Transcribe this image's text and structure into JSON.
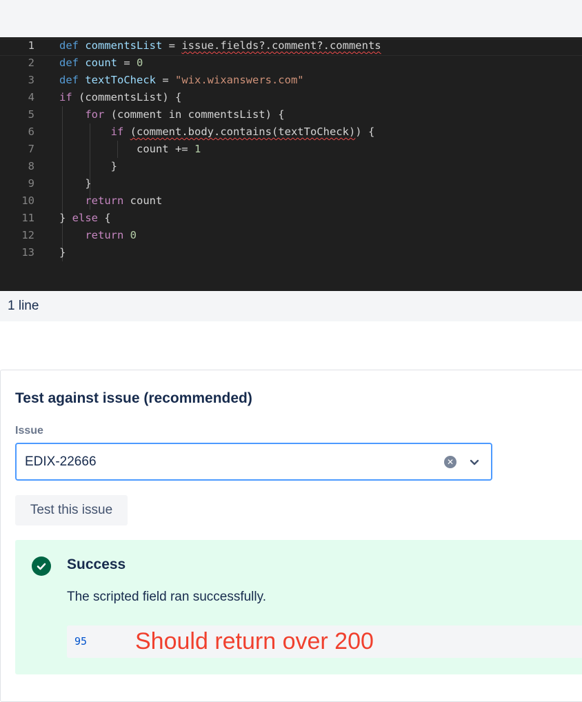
{
  "editor": {
    "line_numbers": [
      "1",
      "2",
      "3",
      "4",
      "5",
      "6",
      "7",
      "8",
      "9",
      "10",
      "11",
      "12",
      "13"
    ],
    "lines": [
      [
        {
          "t": "def",
          "c": "kw-def"
        },
        {
          "t": " "
        },
        {
          "t": "commentsList",
          "c": "var"
        },
        {
          "t": " = "
        },
        {
          "t": "issue.fields?.comment?.comments",
          "c": "squig"
        }
      ],
      [
        {
          "t": "def",
          "c": "kw-def"
        },
        {
          "t": " "
        },
        {
          "t": "count",
          "c": "var"
        },
        {
          "t": " = "
        },
        {
          "t": "0",
          "c": "num"
        }
      ],
      [
        {
          "t": "def",
          "c": "kw-def"
        },
        {
          "t": " "
        },
        {
          "t": "textToCheck",
          "c": "var"
        },
        {
          "t": " = "
        },
        {
          "t": "\"wix.wixanswers.com\"",
          "c": "str"
        }
      ],
      [
        {
          "t": "if",
          "c": "kw"
        },
        {
          "t": " (commentsList) {"
        }
      ],
      [
        {
          "t": "    "
        },
        {
          "t": "for",
          "c": "kw"
        },
        {
          "t": " (comment in commentsList) {"
        }
      ],
      [
        {
          "t": "        "
        },
        {
          "t": "if",
          "c": "kw"
        },
        {
          "t": " "
        },
        {
          "t": "(comment.body.contains(textToCheck)",
          "c": "squig"
        },
        {
          "t": ") {"
        }
      ],
      [
        {
          "t": "            count += "
        },
        {
          "t": "1",
          "c": "num"
        }
      ],
      [
        {
          "t": "        }"
        }
      ],
      [
        {
          "t": "    }"
        }
      ],
      [
        {
          "t": "    "
        },
        {
          "t": "return",
          "c": "kw"
        },
        {
          "t": " count"
        }
      ],
      [
        {
          "t": "} "
        },
        {
          "t": "else",
          "c": "kw"
        },
        {
          "t": " {"
        }
      ],
      [
        {
          "t": "    "
        },
        {
          "t": "return",
          "c": "kw"
        },
        {
          "t": " "
        },
        {
          "t": "0",
          "c": "num"
        }
      ],
      [
        {
          "t": "}"
        }
      ]
    ]
  },
  "line_count_label": "1 line",
  "test_panel": {
    "title": "Test against issue (recommended)",
    "issue_label": "Issue",
    "issue_value": "EDIX-22666",
    "clear_icon": "clear-icon",
    "chevron_icon": "chevron-down-icon",
    "test_button_label": "Test this issue"
  },
  "result": {
    "status_icon": "check-circle-icon",
    "title": "Success",
    "message": "The scripted field ran successfully.",
    "value": "95",
    "annotation": "Should return over 200"
  },
  "colors": {
    "editor_bg": "#1f1f1f",
    "focus_border": "#4c9aff",
    "success_bg": "#e3fcef",
    "success_icon": "#006644",
    "annotation": "#f0402e"
  }
}
